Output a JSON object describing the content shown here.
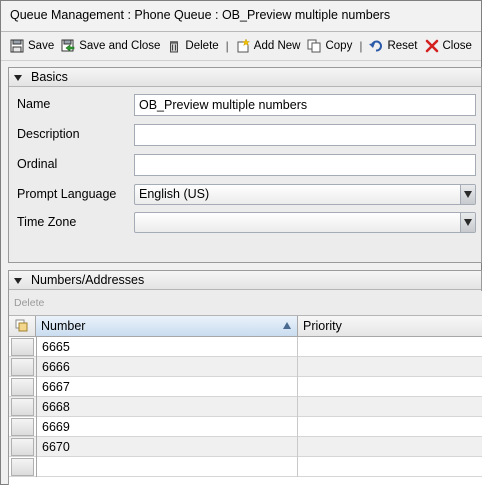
{
  "window": {
    "title": "Queue Management : Phone Queue : OB_Preview multiple numbers"
  },
  "toolbar": {
    "save_label": "Save",
    "save_and_close_label": "Save and Close",
    "delete_label": "Delete",
    "separator": "|",
    "add_new_label": "Add New",
    "copy_label": "Copy",
    "reset_label": "Reset",
    "close_label": "Close",
    "icons": [
      "save-icon",
      "save-and-close-icon",
      "trash-icon",
      "add-new-icon",
      "copy-icon",
      "reset-icon",
      "close-icon"
    ]
  },
  "basics": {
    "header": "Basics",
    "name_label": "Name",
    "name_value": "OB_Preview multiple numbers",
    "description_label": "Description",
    "description_value": "",
    "ordinal_label": "Ordinal",
    "ordinal_value": "",
    "prompt_language_label": "Prompt Language",
    "prompt_language_value": "English (US)",
    "time_zone_label": "Time Zone",
    "time_zone_value": ""
  },
  "numbers": {
    "header": "Numbers/Addresses",
    "delete_label": "Delete",
    "columns": [
      "Number",
      "Priority"
    ],
    "rows": [
      {
        "number": "6665",
        "priority": ""
      },
      {
        "number": "6666",
        "priority": ""
      },
      {
        "number": "6667",
        "priority": ""
      },
      {
        "number": "6668",
        "priority": ""
      },
      {
        "number": "6669",
        "priority": ""
      },
      {
        "number": "6670",
        "priority": ""
      },
      {
        "number": "",
        "priority": ""
      }
    ]
  },
  "colors": {
    "close_red": "#d42020",
    "sorted_header": "#c9dcef"
  }
}
